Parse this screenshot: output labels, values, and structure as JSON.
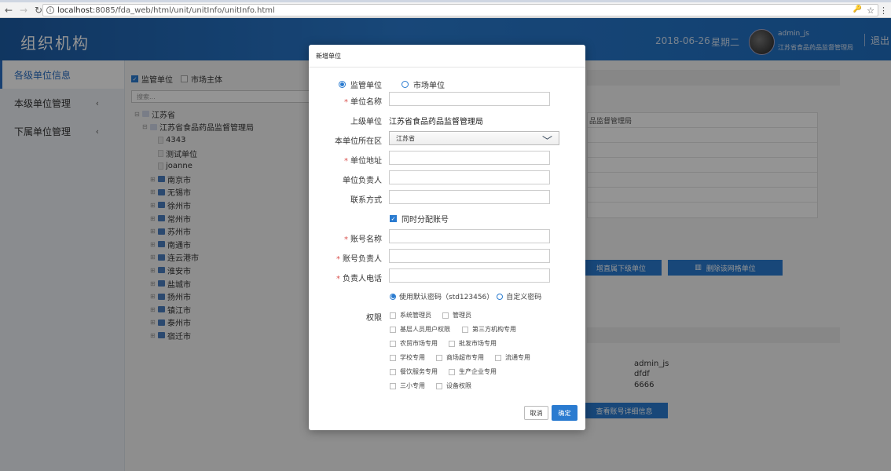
{
  "browser": {
    "url_host": "localhost",
    "url_path": ":8085/fda_web/html/unit/unitInfo/unitInfo.html",
    "info_glyph": "i",
    "key_icon": "🔑",
    "star_icon": "☆",
    "menu_icon": "⋮"
  },
  "header": {
    "title": "组织机构",
    "date": "2018-06-26",
    "weekday": "星期二",
    "user": "admin_js",
    "org": "江苏省食品药品监督管理局",
    "logout": "退出"
  },
  "sidebar": {
    "items": [
      {
        "label": "各级单位信息",
        "chevron": ""
      },
      {
        "label": "本级单位管理",
        "chevron": "‹"
      },
      {
        "label": "下属单位管理",
        "chevron": "‹"
      }
    ]
  },
  "content": {
    "filter": {
      "option1": "监管单位",
      "option2": "市场主体",
      "search_placeholder": "搜索..."
    },
    "tree": [
      "江苏省",
      "江苏省食品药品监督管理局",
      "4343",
      "测试单位",
      "joanne",
      "南京市",
      "无锡市",
      "徐州市",
      "常州市",
      "苏州市",
      "南通市",
      "连云港市",
      "淮安市",
      "盐城市",
      "扬州市",
      "镇江市",
      "泰州市",
      "宿迁市"
    ],
    "detail_parent": "品监督管理局",
    "buttons": {
      "add_sub": "增直属下级单位",
      "delete_grid": "删除该网格单位",
      "view_account": "查看账号详细信息"
    },
    "account": {
      "name": "admin_js",
      "owner": "dfdf",
      "phone": "6666"
    }
  },
  "modal": {
    "title": "新增单位",
    "unit_type": {
      "option1": "监管单位",
      "option2": "市场单位"
    },
    "fields": {
      "unit_name": "单位名称",
      "parent_unit": "上级单位",
      "parent_unit_value": "江苏省食品药品监督管理局",
      "region": "本单位所在区",
      "region_value": "江苏省",
      "address": "单位地址",
      "leader": "单位负责人",
      "contact": "联系方式",
      "assign_account": "同时分配账号",
      "account_name": "账号名称",
      "account_owner": "账号负责人",
      "owner_phone": "负责人电话"
    },
    "password": {
      "default": "使用默认密码（std123456）",
      "custom": "自定义密码"
    },
    "permissions_label": "权限",
    "permissions": [
      [
        "系统管理员",
        "管理员"
      ],
      [
        "基层人员用户权限",
        "第三方机构专用"
      ],
      [
        "农贸市场专用",
        "批发市场专用"
      ],
      [
        "学校专用",
        "商场超市专用",
        "流通专用"
      ],
      [
        "餐饮服务专用",
        "生产企业专用"
      ],
      [
        "三小专用",
        "设备权限"
      ]
    ],
    "cancel": "取消",
    "confirm": "确定"
  }
}
